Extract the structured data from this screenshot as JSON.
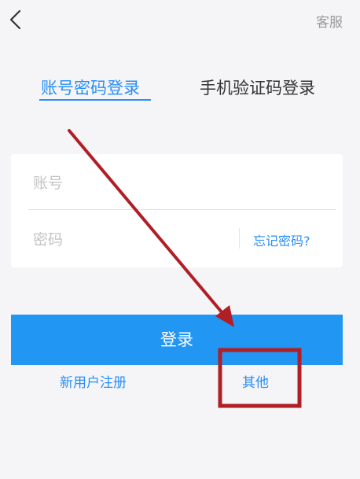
{
  "header": {
    "back_icon": "chevron-left-icon",
    "service_label": "客服"
  },
  "tabs": [
    {
      "label": "账号密码登录",
      "active": true
    },
    {
      "label": "手机验证码登录",
      "active": false
    }
  ],
  "form": {
    "account_placeholder": "账号",
    "password_placeholder": "密码",
    "forgot_label": "忘记密码?"
  },
  "actions": {
    "login_label": "登录",
    "register_label": "新用户注册",
    "other_label": "其他"
  },
  "colors": {
    "accent": "#2a8ff7",
    "button": "#2196f3",
    "annotation": "#b01e26"
  }
}
